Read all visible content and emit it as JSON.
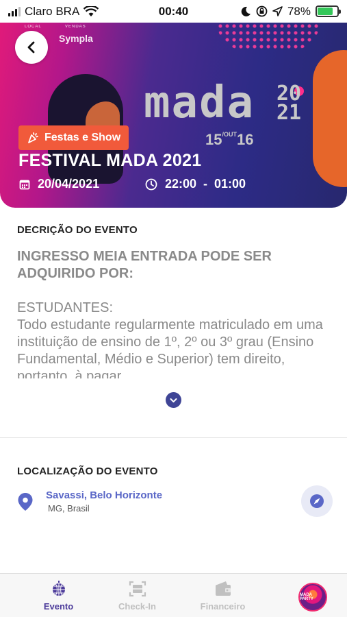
{
  "status_bar": {
    "carrier": "Claro BRA",
    "time": "00:40",
    "battery": "78%"
  },
  "hero": {
    "brand_local": "LOCAL",
    "brand_vendas": "VENDAS",
    "brand_sympla": "Sympla",
    "logo_text": "mada",
    "logo_year_top": "20",
    "logo_year_bottom": "21",
    "logo_dates": "15",
    "logo_dates_out": "/OUT",
    "logo_dates_end": "16",
    "category": "Festas e Show",
    "title": "FESTIVAL MADA 2021",
    "date": "20/04/2021",
    "time_range": "22:00  -  01:00"
  },
  "description": {
    "heading": "DECRIÇÃO DO EVENTO",
    "title_line": "INGRESSO MEIA ENTRADA PODE SER ADQUIRIDO POR:",
    "sub_heading": "ESTUDANTES:",
    "body": "Todo estudante regularmente matriculado em uma instituição de ensino de 1º, 2º ou 3º grau (Ensino Fundamental, Médio e Superior) tem direito, portanto, à pagar"
  },
  "location": {
    "heading": "LOCALIZAÇÃO DO EVENTO",
    "name": "Savassi, Belo Horizonte",
    "sub": "MG, Brasil"
  },
  "tabs": [
    {
      "label": "Evento",
      "active": true
    },
    {
      "label": "Check-In",
      "active": false
    },
    {
      "label": "Financeiro",
      "active": false
    }
  ],
  "avatar_text": "MADA PARTY",
  "colors": {
    "accent": "#4c3b9a",
    "tag": "#f15a3b",
    "link": "#5a67c7"
  }
}
